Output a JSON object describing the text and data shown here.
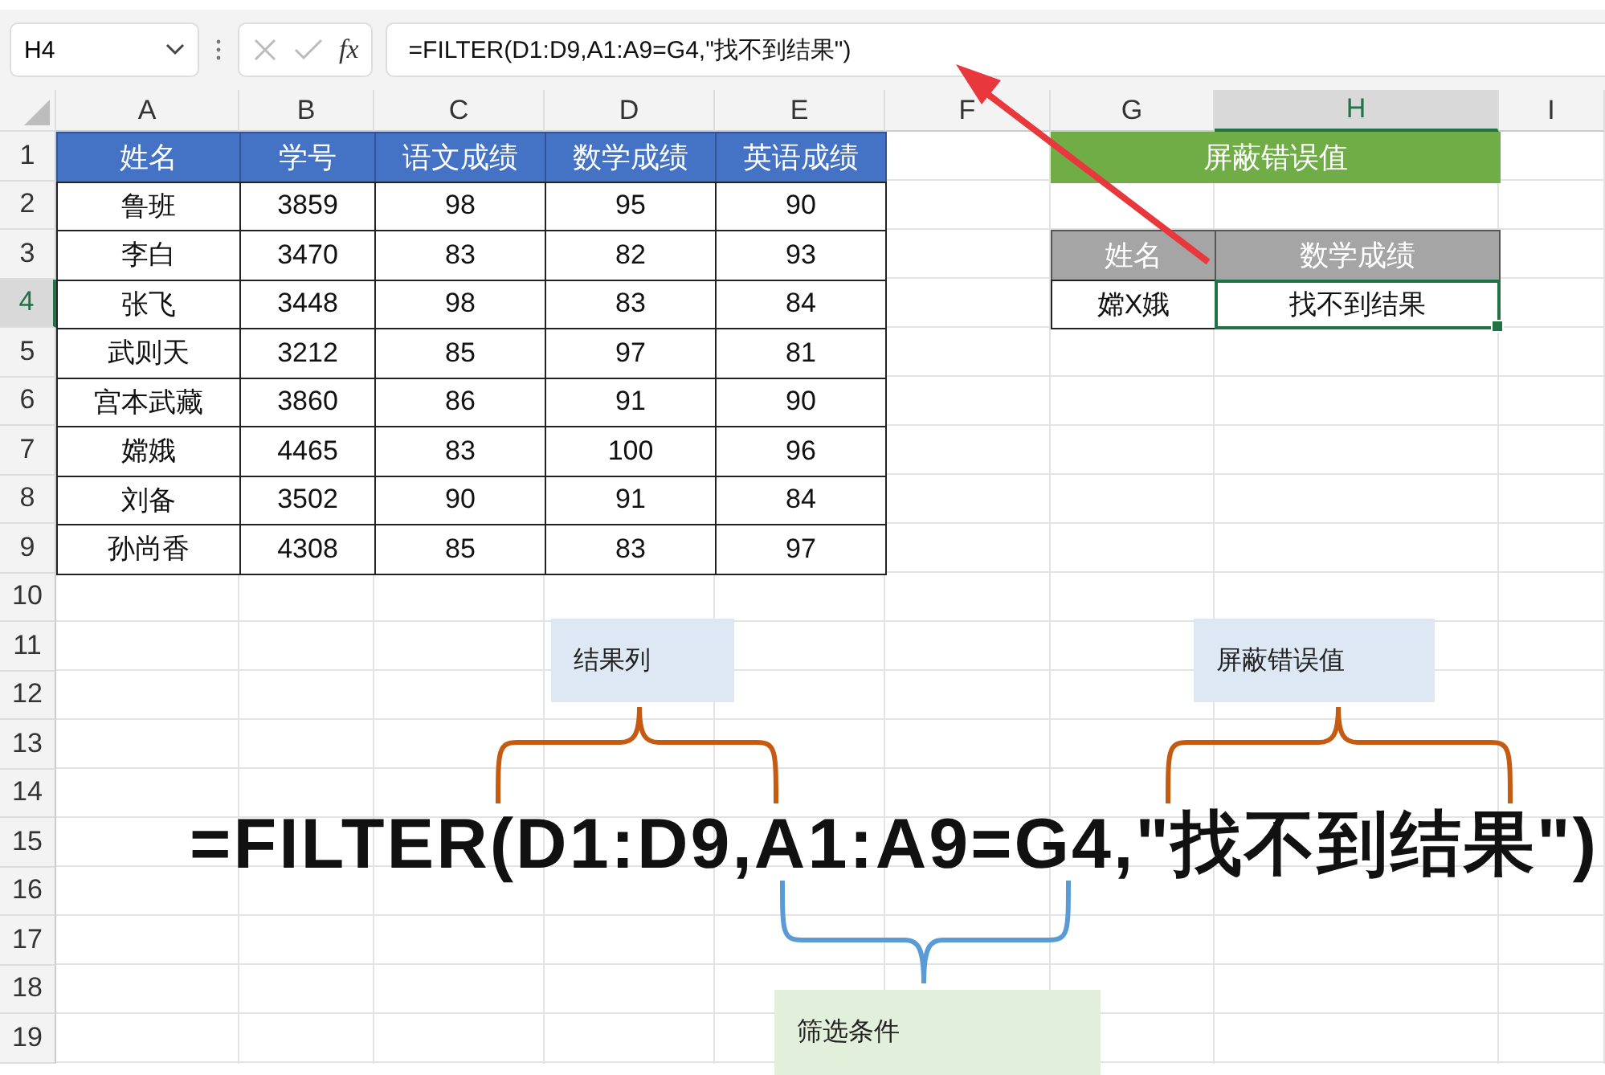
{
  "name_box": {
    "value": "H4"
  },
  "function_button": "fx",
  "formula_bar": {
    "value": "=FILTER(D1:D9,A1:A9=G4,\"找不到结果\")"
  },
  "column_headers": [
    {
      "label": "A",
      "selected": false
    },
    {
      "label": "B",
      "selected": false
    },
    {
      "label": "C",
      "selected": false
    },
    {
      "label": "D",
      "selected": false
    },
    {
      "label": "E",
      "selected": false
    },
    {
      "label": "F",
      "selected": false
    },
    {
      "label": "G",
      "selected": false
    },
    {
      "label": "H",
      "selected": true
    },
    {
      "label": "I",
      "selected": false
    }
  ],
  "row_headers": [
    {
      "label": "1",
      "selected": false
    },
    {
      "label": "2",
      "selected": false
    },
    {
      "label": "3",
      "selected": false
    },
    {
      "label": "4",
      "selected": true
    },
    {
      "label": "5",
      "selected": false
    },
    {
      "label": "6",
      "selected": false
    },
    {
      "label": "7",
      "selected": false
    },
    {
      "label": "8",
      "selected": false
    },
    {
      "label": "9",
      "selected": false
    },
    {
      "label": "10",
      "selected": false
    },
    {
      "label": "11",
      "selected": false
    },
    {
      "label": "12",
      "selected": false
    },
    {
      "label": "13",
      "selected": false
    },
    {
      "label": "14",
      "selected": false
    },
    {
      "label": "15",
      "selected": false
    },
    {
      "label": "16",
      "selected": false
    },
    {
      "label": "17",
      "selected": false
    },
    {
      "label": "18",
      "selected": false
    },
    {
      "label": "19",
      "selected": false
    }
  ],
  "student_table": {
    "columns": [
      "姓名",
      "学号",
      "语文成绩",
      "数学成绩",
      "英语成绩"
    ],
    "rows": [
      [
        "鲁班",
        "3859",
        "98",
        "95",
        "90"
      ],
      [
        "李白",
        "3470",
        "83",
        "82",
        "93"
      ],
      [
        "张飞",
        "3448",
        "98",
        "83",
        "84"
      ],
      [
        "武则天",
        "3212",
        "85",
        "97",
        "81"
      ],
      [
        "宫本武藏",
        "3860",
        "86",
        "91",
        "90"
      ],
      [
        "嫦娥",
        "4465",
        "83",
        "100",
        "96"
      ],
      [
        "刘备",
        "3502",
        "90",
        "91",
        "84"
      ],
      [
        "孙尚香",
        "4308",
        "85",
        "83",
        "97"
      ]
    ]
  },
  "lookup": {
    "title": "屏蔽错误值",
    "columns": [
      "姓名",
      "数学成绩"
    ],
    "row": [
      {
        "value": "嫦X娥",
        "selected": false
      },
      {
        "value": "找不到结果",
        "selected": true
      }
    ]
  },
  "annotation": {
    "formula": "=FILTER(D1:D9,A1:A9=G4,\"找不到结果\")",
    "labels": [
      {
        "text": "结果列",
        "kind": "top",
        "color": "#c55a11"
      },
      {
        "text": "屏蔽错误值",
        "kind": "top",
        "color": "#c55a11"
      },
      {
        "text": "筛选条件",
        "kind": "bottom",
        "color": "#5b9bd5"
      }
    ]
  }
}
